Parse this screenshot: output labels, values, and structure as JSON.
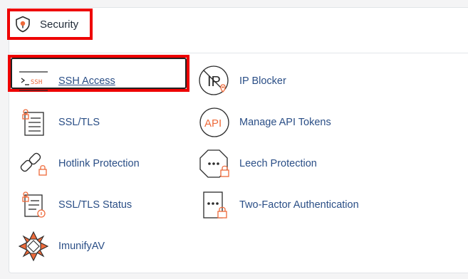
{
  "header": {
    "title": "Security",
    "icon": "shield-icon"
  },
  "items": [
    {
      "label": "SSH Access",
      "icon": "ssh-terminal-icon",
      "selected": true
    },
    {
      "label": "IP Blocker",
      "icon": "ip-blocker-icon"
    },
    {
      "label": "SSL/TLS",
      "icon": "ssl-certificate-icon"
    },
    {
      "label": "Manage API Tokens",
      "icon": "api-icon"
    },
    {
      "label": "Hotlink Protection",
      "icon": "hotlink-chain-icon"
    },
    {
      "label": "Leech Protection",
      "icon": "leech-protection-icon"
    },
    {
      "label": "SSL/TLS Status",
      "icon": "ssl-status-icon"
    },
    {
      "label": "Two-Factor Authentication",
      "icon": "two-factor-icon"
    },
    {
      "label": "ImunifyAV",
      "icon": "imunifyav-icon"
    }
  ],
  "ssh_icon_text": "SSH",
  "api_icon_text": "API",
  "ip_icon_text": "IP",
  "colors": {
    "accent": "#ee6a3a",
    "highlight": "#ee0000",
    "link": "#2a4e86",
    "icon_stroke": "#2b2b2b"
  }
}
